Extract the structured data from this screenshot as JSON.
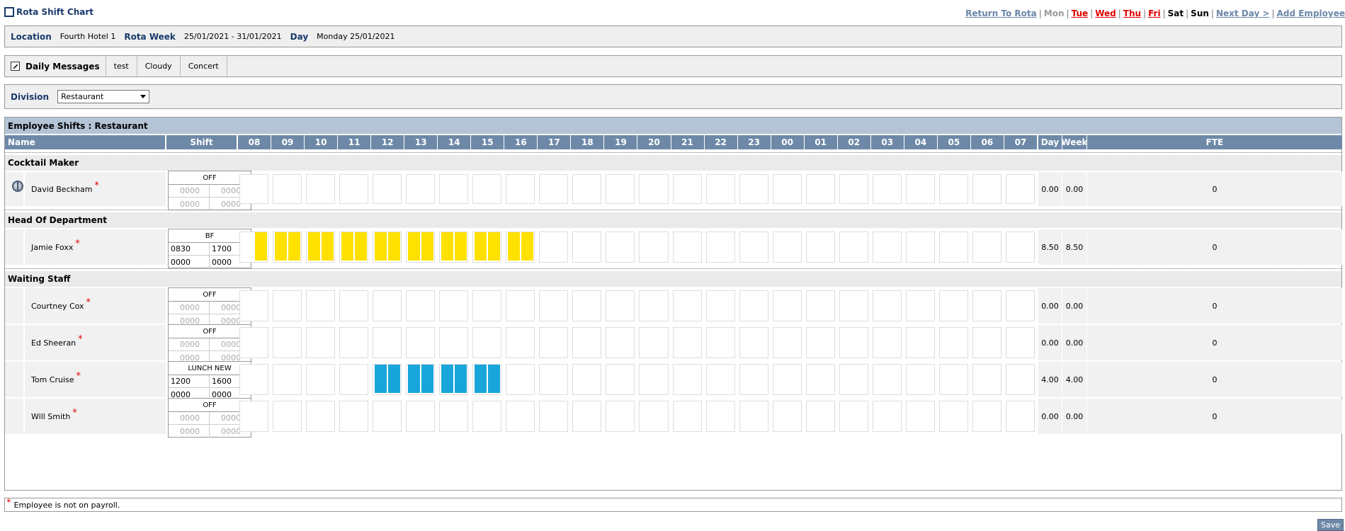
{
  "header": {
    "title": "Rota Shift Chart",
    "nav": [
      {
        "label": "Return To Rota",
        "style": "navlink"
      },
      {
        "label": "Mon",
        "style": "day-grey"
      },
      {
        "label": "Tue",
        "style": "day-red"
      },
      {
        "label": "Wed",
        "style": "day-red"
      },
      {
        "label": "Thu",
        "style": "day-red"
      },
      {
        "label": "Fri",
        "style": "day-red"
      },
      {
        "label": "Sat",
        "style": "day-black"
      },
      {
        "label": "Sun",
        "style": "day-black"
      },
      {
        "label": "Next Day >",
        "style": "navlink"
      },
      {
        "label": "Add Employee",
        "style": "navlink"
      }
    ]
  },
  "info": {
    "location_label": "Location",
    "location": "Fourth Hotel 1",
    "week_label": "Rota Week",
    "week": "25/01/2021 - 31/01/2021",
    "day_label": "Day",
    "day": "Monday 25/01/2021"
  },
  "messages": {
    "label": "Daily Messages",
    "items": [
      "test",
      "Cloudy",
      "Concert"
    ]
  },
  "division": {
    "label": "Division",
    "selected": "Restaurant"
  },
  "grid": {
    "title": "Employee Shifts : Restaurant",
    "col_name": "Name",
    "col_shift": "Shift",
    "hours": [
      "08",
      "09",
      "10",
      "11",
      "12",
      "13",
      "14",
      "15",
      "16",
      "17",
      "18",
      "19",
      "20",
      "21",
      "22",
      "23",
      "00",
      "01",
      "02",
      "03",
      "04",
      "05",
      "06",
      "07"
    ],
    "col_day": "Day",
    "col_week": "Week",
    "col_fte": "FTE",
    "groups": [
      {
        "name": "Cocktail Maker",
        "employees": [
          {
            "name": "David Beckham",
            "icon": "globe-icon",
            "shift": "OFF",
            "times": [
              "0000",
              "0000",
              "0000",
              "0000"
            ],
            "day": "0.00",
            "week": "0.00",
            "fte": "0"
          }
        ]
      },
      {
        "name": "Head Of Department",
        "employees": [
          {
            "name": "Jamie Foxx",
            "shift": "BF",
            "times": [
              "0830",
              "1700",
              "0000",
              "0000"
            ],
            "day": "8.50",
            "week": "8.50",
            "fte": "0",
            "color": "#ffe100"
          }
        ]
      },
      {
        "name": "Waiting Staff",
        "employees": [
          {
            "name": "Courtney Cox",
            "shift": "OFF",
            "times": [
              "0000",
              "0000",
              "0000",
              "0000"
            ],
            "day": "0.00",
            "week": "0.00",
            "fte": "0"
          },
          {
            "name": "Ed Sheeran",
            "shift": "OFF",
            "times": [
              "0000",
              "0000",
              "0000",
              "0000"
            ],
            "day": "0.00",
            "week": "0.00",
            "fte": "0"
          },
          {
            "name": "Tom Cruise",
            "shift": "LUNCH NEW",
            "times": [
              "1200",
              "1600",
              "0000",
              "0000"
            ],
            "day": "4.00",
            "week": "4.00",
            "fte": "0",
            "color": "#18a6da"
          },
          {
            "name": "Will Smith",
            "shift": "OFF",
            "times": [
              "0000",
              "0000",
              "0000",
              "0000"
            ],
            "day": "0.00",
            "week": "0.00",
            "fte": "0"
          }
        ]
      }
    ]
  },
  "legend": "Employee is not on payroll.",
  "save_label": "Save"
}
